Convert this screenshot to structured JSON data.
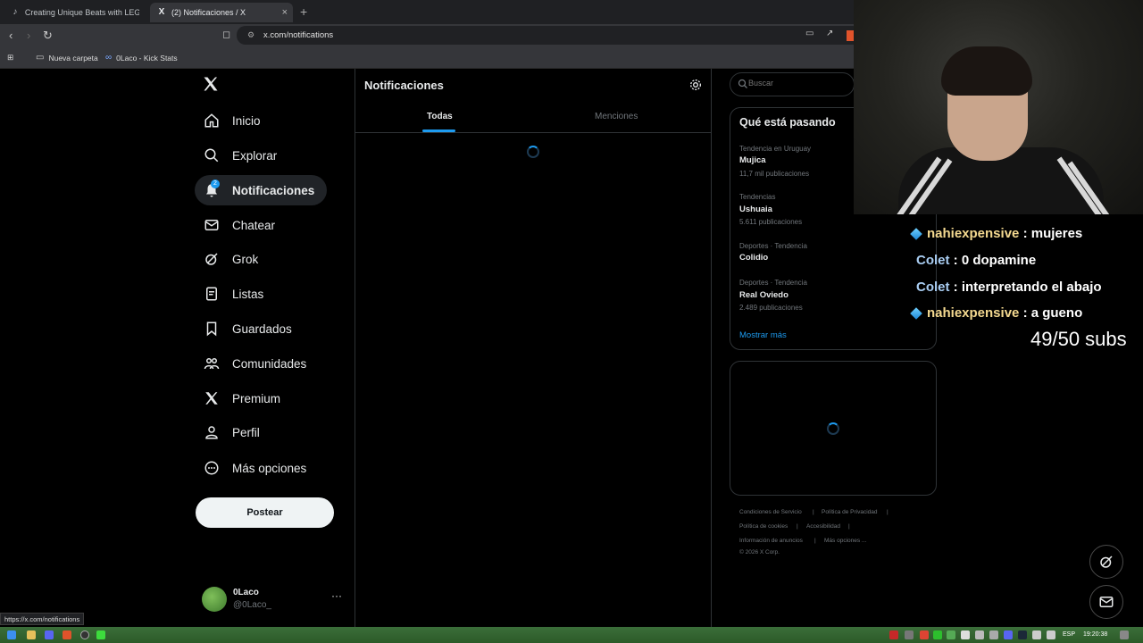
{
  "browser": {
    "tabs": [
      {
        "label": "Creating Unique Beats with LEGOs in"
      },
      {
        "label": "(2) Notificaciones / X"
      }
    ],
    "url": "x.com/notifications",
    "bookmarks": [
      {
        "label": "Nueva carpeta"
      },
      {
        "label": "0Laco - Kick Stats"
      }
    ],
    "status_url": "https://x.com/notifications"
  },
  "sidebar": {
    "badge_count": "2",
    "items": [
      {
        "label": "Inicio",
        "icon": "home-icon"
      },
      {
        "label": "Explorar",
        "icon": "search-icon"
      },
      {
        "label": "Notificaciones",
        "icon": "bell-icon"
      },
      {
        "label": "Chatear",
        "icon": "mail-icon"
      },
      {
        "label": "Grok",
        "icon": "grok-icon"
      },
      {
        "label": "Listas",
        "icon": "list-icon"
      },
      {
        "label": "Guardados",
        "icon": "bookmark-icon"
      },
      {
        "label": "Comunidades",
        "icon": "community-icon"
      },
      {
        "label": "Premium",
        "icon": "x-icon"
      },
      {
        "label": "Perfil",
        "icon": "person-icon"
      },
      {
        "label": "Más opciones",
        "icon": "more-circle-icon"
      }
    ],
    "post_label": "Postear",
    "profile": {
      "name": "0Laco",
      "handle": "@0Laco_"
    }
  },
  "main": {
    "title": "Notificaciones",
    "tabs": [
      {
        "label": "Todas"
      },
      {
        "label": "Menciones"
      }
    ]
  },
  "right": {
    "search_placeholder": "Buscar",
    "trends_title": "Qué está pasando",
    "trends": [
      {
        "context": "Tendencia en Uruguay",
        "name": "Mujica",
        "count": "11,7 mil publicaciones"
      },
      {
        "context": "Tendencias",
        "name": "Ushuaia",
        "count": "5.611 publicaciones"
      },
      {
        "context": "Deportes · Tendencia",
        "name": "Colidio",
        "count": ""
      },
      {
        "context": "Deportes · Tendencia",
        "name": "Real Oviedo",
        "count": "2.489 publicaciones"
      }
    ],
    "show_more": "Mostrar más",
    "footer": {
      "terms": "Condiciones de Servicio",
      "privacy": "Política de Privacidad",
      "cookies": "Política de cookies",
      "accessibility": "Accesibilidad",
      "ads": "Información de anuncios",
      "more": "Más opciones ...",
      "copyright": "© 2026 X Corp."
    }
  },
  "overlay": {
    "chat": [
      {
        "user": "nahiexpensive",
        "message": ": mujeres"
      },
      {
        "user": "Colet",
        "message": ": 0 dopamine"
      },
      {
        "user": "Colet",
        "message": ": interpretando el abajo"
      },
      {
        "user": "nahiexpensive",
        "message": ": a gueno"
      }
    ],
    "subs": "49/50 subs"
  },
  "taskbar": {
    "lang": "ESP",
    "time": "19:20:38"
  },
  "colors": {
    "accent": "#1d9bf0",
    "background": "#000000",
    "border": "#2f3336"
  }
}
